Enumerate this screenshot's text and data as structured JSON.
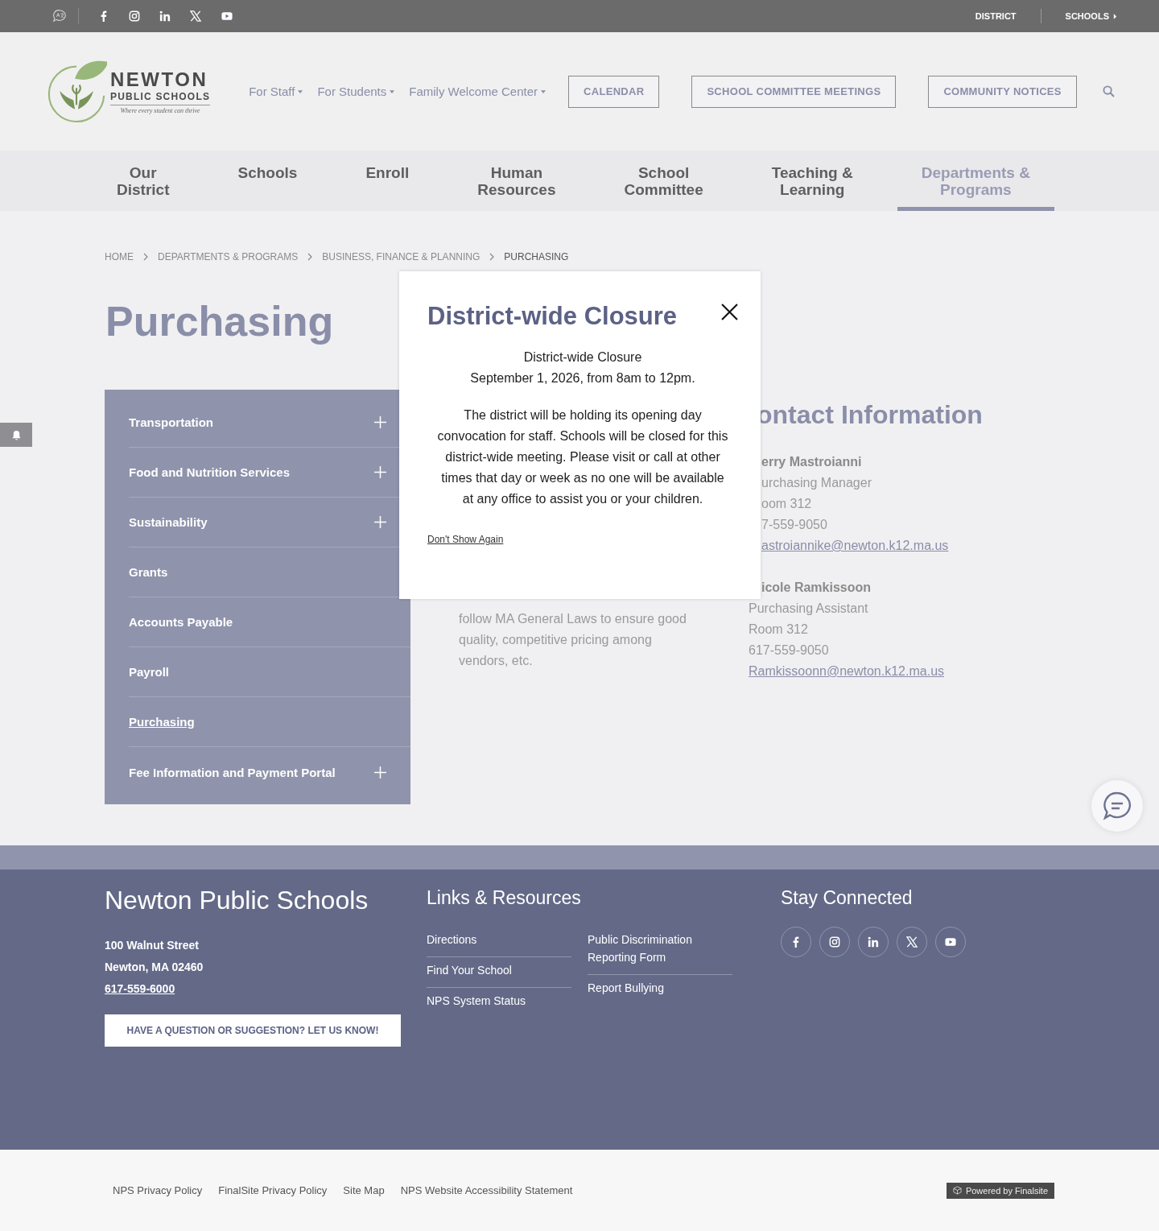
{
  "top_bar": {
    "links": [
      {
        "label": "DISTRICT",
        "has_menu": false
      },
      {
        "label": "SCHOOLS",
        "has_menu": true
      }
    ]
  },
  "header": {
    "logo": {
      "name": "NEWTON",
      "subtitle": "PUBLIC SCHOOLS",
      "tagline": "Where every student can thrive"
    },
    "utility_links": [
      {
        "label": "For Staff"
      },
      {
        "label": "For Students"
      },
      {
        "label": "Family Welcome Center"
      }
    ],
    "buttons": [
      "CALENDAR",
      "SCHOOL COMMITTEE MEETINGS",
      "COMMUNITY NOTICES"
    ]
  },
  "main_nav": [
    {
      "label": "Our\nDistrict",
      "selected": false
    },
    {
      "label": "Schools",
      "selected": false
    },
    {
      "label": "Enroll",
      "selected": false
    },
    {
      "label": "Human\nResources",
      "selected": false
    },
    {
      "label": "School\nCommittee",
      "selected": false
    },
    {
      "label": "Teaching &\nLearning",
      "selected": false
    },
    {
      "label": "Departments &\nPrograms",
      "selected": true
    }
  ],
  "breadcrumb": [
    {
      "label": "HOME",
      "current": false
    },
    {
      "label": "DEPARTMENTS & PROGRAMS",
      "current": false
    },
    {
      "label": "BUSINESS, FINANCE & PLANNING",
      "current": false
    },
    {
      "label": "PURCHASING",
      "current": true
    }
  ],
  "page_title": "Purchasing",
  "sidebar": {
    "items": [
      {
        "label": "Transportation",
        "expandable": true,
        "selected": false
      },
      {
        "label": "Food and Nutrition Services",
        "expandable": true,
        "selected": false
      },
      {
        "label": "Sustainability",
        "expandable": true,
        "selected": false
      },
      {
        "label": "Grants",
        "expandable": false,
        "selected": false
      },
      {
        "label": "Accounts Payable",
        "expandable": false,
        "selected": false
      },
      {
        "label": "Payroll",
        "expandable": false,
        "selected": false
      },
      {
        "label": "Purchasing",
        "expandable": false,
        "selected": true
      },
      {
        "label": "Fee Information and Payment Portal",
        "expandable": true,
        "selected": false
      }
    ]
  },
  "description": "follow MA General Laws to ensure good quality, competitive pricing among vendors, etc.",
  "contact": {
    "title": "ontact Information",
    "people": [
      {
        "name": "erry Mastroianni",
        "role": "urchasing Manager",
        "room": "oom 312",
        "phone": "7-559-9050",
        "email": "astroiannike@newton.k12.ma.us"
      },
      {
        "name": "icole Ramkissoon",
        "role": "Purchasing Assistant",
        "room": "Room 312",
        "phone": "617-559-9050",
        "email": "Ramkissoonn@newton.k12.ma.us"
      }
    ]
  },
  "modal": {
    "title": "District-wide Closure",
    "lines": [
      "District-wide Closure",
      "September 1, 2026, from 8am to 12pm."
    ],
    "body": "The district will be holding its opening day convocation for staff. Schools will be closed for this district-wide meeting. Please visit or call at other times that day or week as no one will be available at any office to assist you or your children.",
    "dismiss_link": "Don't Show Again"
  },
  "footer": {
    "name": "Newton Public Schools",
    "address": [
      "100 Walnut Street",
      "Newton, MA  02460"
    ],
    "phone": "617-559-6000",
    "cta": "HAVE A QUESTION OR SUGGESTION? LET US KNOW!",
    "links_title": "Links & Resources",
    "links_col_1": [
      "Directions",
      "Find Your School",
      "NPS System Status"
    ],
    "links_col_2": [
      "Public Discrimination Reporting Form",
      "Report Bullying"
    ],
    "social_title": "Stay Connected"
  },
  "bottom_bar": {
    "links": [
      "NPS Privacy Policy",
      "FinalSite Privacy Policy",
      "Site Map",
      "NPS Website Accessibility Statement"
    ],
    "badge": "Powered by Finalsite"
  }
}
